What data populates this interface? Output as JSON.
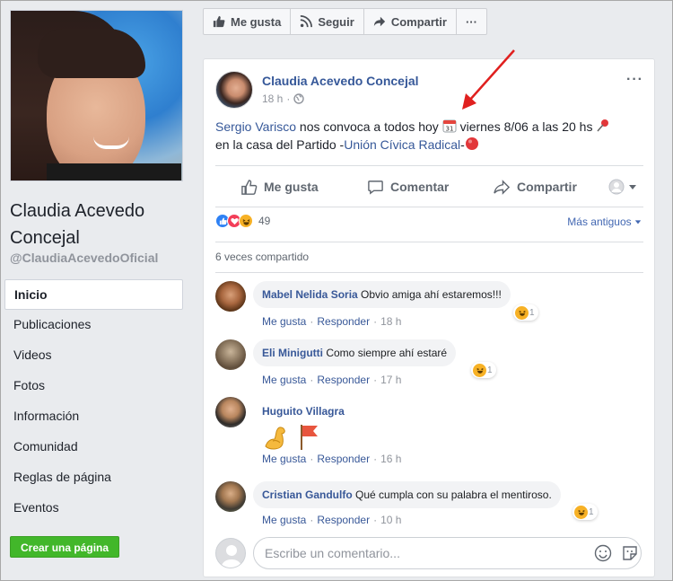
{
  "page": {
    "name": "Claudia Acevedo Concejal",
    "handle": "@ClaudiaAcevedoOficial",
    "nav": [
      "Inicio",
      "Publicaciones",
      "Videos",
      "Fotos",
      "Información",
      "Comunidad",
      "Reglas de página",
      "Eventos"
    ],
    "active_nav": "Inicio",
    "create_page_label": "Crear una página"
  },
  "actionbar": {
    "like_label": "Me gusta",
    "follow_label": "Seguir",
    "share_label": "Compartir",
    "more_label": "···"
  },
  "post": {
    "author": "Claudia Acevedo Concejal",
    "time": "18 h",
    "dots": "···",
    "text": {
      "mention": "Sergio Varisco",
      "part1": " nos convoca a todos hoy ",
      "part2": " viernes 8/06 a las 20 hs ",
      "part3": "en la casa del Partido -",
      "party": "Unión Cívica Radical",
      "part4": "-"
    },
    "actions": {
      "like": "Me gusta",
      "comment": "Comentar",
      "share": "Compartir"
    },
    "reaction_count": "49",
    "older_label": "Más antiguos",
    "shared_label": "6 veces compartido"
  },
  "comments": [
    {
      "name": "Mabel Nelida Soria",
      "text": "Obvio amiga ahí estaremos!!!",
      "like": "Me gusta",
      "reply": "Responder",
      "time": "18 h",
      "reacts": "1"
    },
    {
      "name": "Eli Minigutti",
      "text": "Como siempre ahí estaré",
      "like": "Me gusta",
      "reply": "Responder",
      "time": "17 h",
      "reacts": "1"
    },
    {
      "name": "Huguito Villagra",
      "text": "",
      "like": "Me gusta",
      "reply": "Responder",
      "time": "16 h",
      "emoji": [
        "muscle-emoji",
        "flag-emoji"
      ]
    },
    {
      "name": "Cristian Gandulfo",
      "text": "Qué cumpla con su palabra el mentiroso.",
      "like": "Me gusta",
      "reply": "Responder",
      "time": "10 h",
      "reacts": "1"
    }
  ],
  "composer": {
    "placeholder": "Escribe un comentario..."
  },
  "colors": {
    "link_blue": "#365899",
    "create_green": "#42b72a",
    "annotation_arrow": "#e0201f"
  }
}
